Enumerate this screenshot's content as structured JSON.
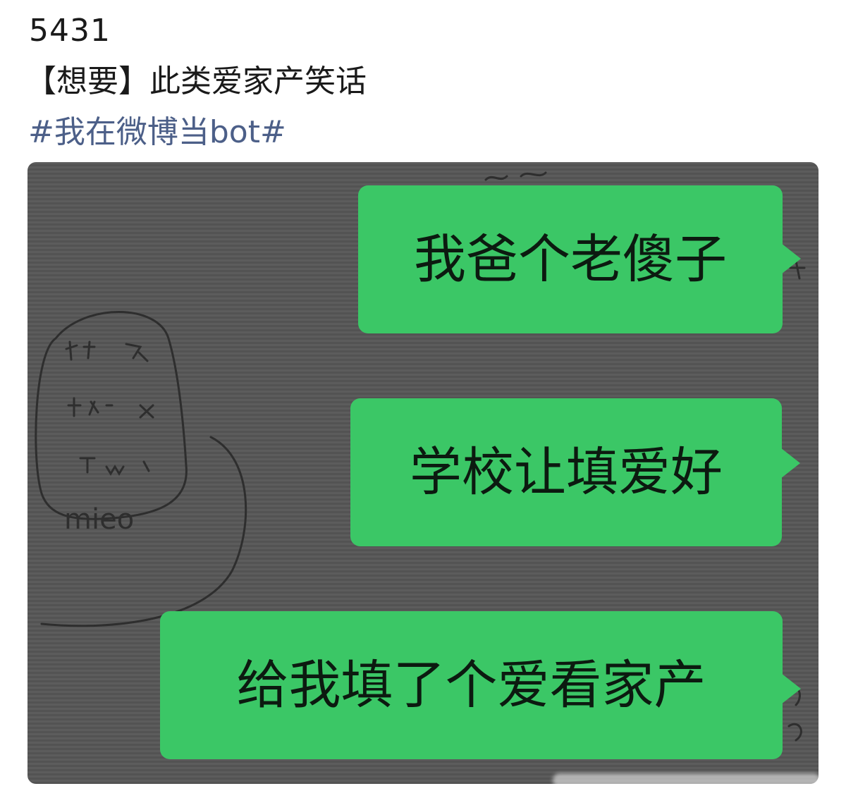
{
  "post": {
    "id_text": "5431",
    "body_text": "【想要】此类爱家产笑话",
    "hashtag": "#我在微博当bot#"
  },
  "image": {
    "background_color": "#595959",
    "bubble_color": "#3bc766",
    "messages": [
      "我爸个老傻子",
      "学校让填爱好",
      "给我填了个爱看家产"
    ],
    "doodle_text": "mieo"
  }
}
